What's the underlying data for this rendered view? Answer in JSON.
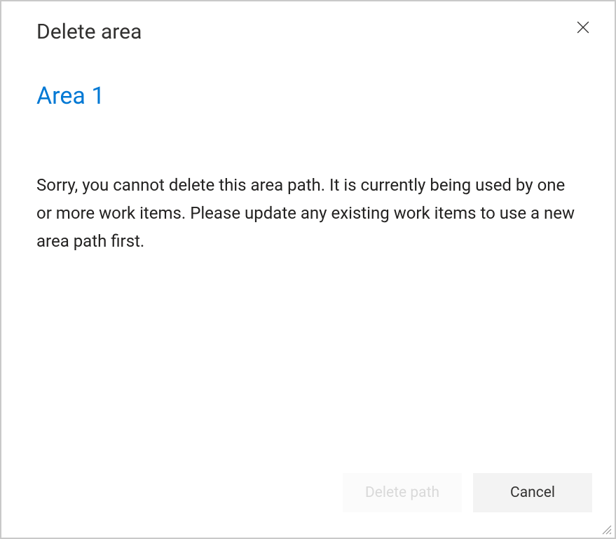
{
  "dialog": {
    "title": "Delete area",
    "area_name": "Area 1",
    "message": "Sorry, you cannot delete this area path. It is currently being used by one or more work items. Please update any existing work items to use a new area path first.",
    "buttons": {
      "delete_label": "Delete path",
      "cancel_label": "Cancel"
    }
  }
}
